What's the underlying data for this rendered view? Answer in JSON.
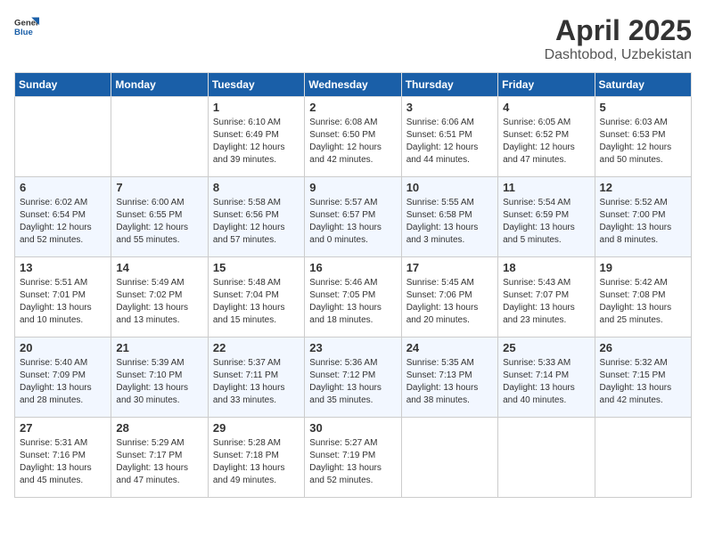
{
  "header": {
    "logo_general": "General",
    "logo_blue": "Blue",
    "month": "April 2025",
    "location": "Dashtobod, Uzbekistan"
  },
  "weekdays": [
    "Sunday",
    "Monday",
    "Tuesday",
    "Wednesday",
    "Thursday",
    "Friday",
    "Saturday"
  ],
  "weeks": [
    [
      {
        "day": "",
        "content": ""
      },
      {
        "day": "",
        "content": ""
      },
      {
        "day": "1",
        "content": "Sunrise: 6:10 AM\nSunset: 6:49 PM\nDaylight: 12 hours\nand 39 minutes."
      },
      {
        "day": "2",
        "content": "Sunrise: 6:08 AM\nSunset: 6:50 PM\nDaylight: 12 hours\nand 42 minutes."
      },
      {
        "day": "3",
        "content": "Sunrise: 6:06 AM\nSunset: 6:51 PM\nDaylight: 12 hours\nand 44 minutes."
      },
      {
        "day": "4",
        "content": "Sunrise: 6:05 AM\nSunset: 6:52 PM\nDaylight: 12 hours\nand 47 minutes."
      },
      {
        "day": "5",
        "content": "Sunrise: 6:03 AM\nSunset: 6:53 PM\nDaylight: 12 hours\nand 50 minutes."
      }
    ],
    [
      {
        "day": "6",
        "content": "Sunrise: 6:02 AM\nSunset: 6:54 PM\nDaylight: 12 hours\nand 52 minutes."
      },
      {
        "day": "7",
        "content": "Sunrise: 6:00 AM\nSunset: 6:55 PM\nDaylight: 12 hours\nand 55 minutes."
      },
      {
        "day": "8",
        "content": "Sunrise: 5:58 AM\nSunset: 6:56 PM\nDaylight: 12 hours\nand 57 minutes."
      },
      {
        "day": "9",
        "content": "Sunrise: 5:57 AM\nSunset: 6:57 PM\nDaylight: 13 hours\nand 0 minutes."
      },
      {
        "day": "10",
        "content": "Sunrise: 5:55 AM\nSunset: 6:58 PM\nDaylight: 13 hours\nand 3 minutes."
      },
      {
        "day": "11",
        "content": "Sunrise: 5:54 AM\nSunset: 6:59 PM\nDaylight: 13 hours\nand 5 minutes."
      },
      {
        "day": "12",
        "content": "Sunrise: 5:52 AM\nSunset: 7:00 PM\nDaylight: 13 hours\nand 8 minutes."
      }
    ],
    [
      {
        "day": "13",
        "content": "Sunrise: 5:51 AM\nSunset: 7:01 PM\nDaylight: 13 hours\nand 10 minutes."
      },
      {
        "day": "14",
        "content": "Sunrise: 5:49 AM\nSunset: 7:02 PM\nDaylight: 13 hours\nand 13 minutes."
      },
      {
        "day": "15",
        "content": "Sunrise: 5:48 AM\nSunset: 7:04 PM\nDaylight: 13 hours\nand 15 minutes."
      },
      {
        "day": "16",
        "content": "Sunrise: 5:46 AM\nSunset: 7:05 PM\nDaylight: 13 hours\nand 18 minutes."
      },
      {
        "day": "17",
        "content": "Sunrise: 5:45 AM\nSunset: 7:06 PM\nDaylight: 13 hours\nand 20 minutes."
      },
      {
        "day": "18",
        "content": "Sunrise: 5:43 AM\nSunset: 7:07 PM\nDaylight: 13 hours\nand 23 minutes."
      },
      {
        "day": "19",
        "content": "Sunrise: 5:42 AM\nSunset: 7:08 PM\nDaylight: 13 hours\nand 25 minutes."
      }
    ],
    [
      {
        "day": "20",
        "content": "Sunrise: 5:40 AM\nSunset: 7:09 PM\nDaylight: 13 hours\nand 28 minutes."
      },
      {
        "day": "21",
        "content": "Sunrise: 5:39 AM\nSunset: 7:10 PM\nDaylight: 13 hours\nand 30 minutes."
      },
      {
        "day": "22",
        "content": "Sunrise: 5:37 AM\nSunset: 7:11 PM\nDaylight: 13 hours\nand 33 minutes."
      },
      {
        "day": "23",
        "content": "Sunrise: 5:36 AM\nSunset: 7:12 PM\nDaylight: 13 hours\nand 35 minutes."
      },
      {
        "day": "24",
        "content": "Sunrise: 5:35 AM\nSunset: 7:13 PM\nDaylight: 13 hours\nand 38 minutes."
      },
      {
        "day": "25",
        "content": "Sunrise: 5:33 AM\nSunset: 7:14 PM\nDaylight: 13 hours\nand 40 minutes."
      },
      {
        "day": "26",
        "content": "Sunrise: 5:32 AM\nSunset: 7:15 PM\nDaylight: 13 hours\nand 42 minutes."
      }
    ],
    [
      {
        "day": "27",
        "content": "Sunrise: 5:31 AM\nSunset: 7:16 PM\nDaylight: 13 hours\nand 45 minutes."
      },
      {
        "day": "28",
        "content": "Sunrise: 5:29 AM\nSunset: 7:17 PM\nDaylight: 13 hours\nand 47 minutes."
      },
      {
        "day": "29",
        "content": "Sunrise: 5:28 AM\nSunset: 7:18 PM\nDaylight: 13 hours\nand 49 minutes."
      },
      {
        "day": "30",
        "content": "Sunrise: 5:27 AM\nSunset: 7:19 PM\nDaylight: 13 hours\nand 52 minutes."
      },
      {
        "day": "",
        "content": ""
      },
      {
        "day": "",
        "content": ""
      },
      {
        "day": "",
        "content": ""
      }
    ]
  ]
}
